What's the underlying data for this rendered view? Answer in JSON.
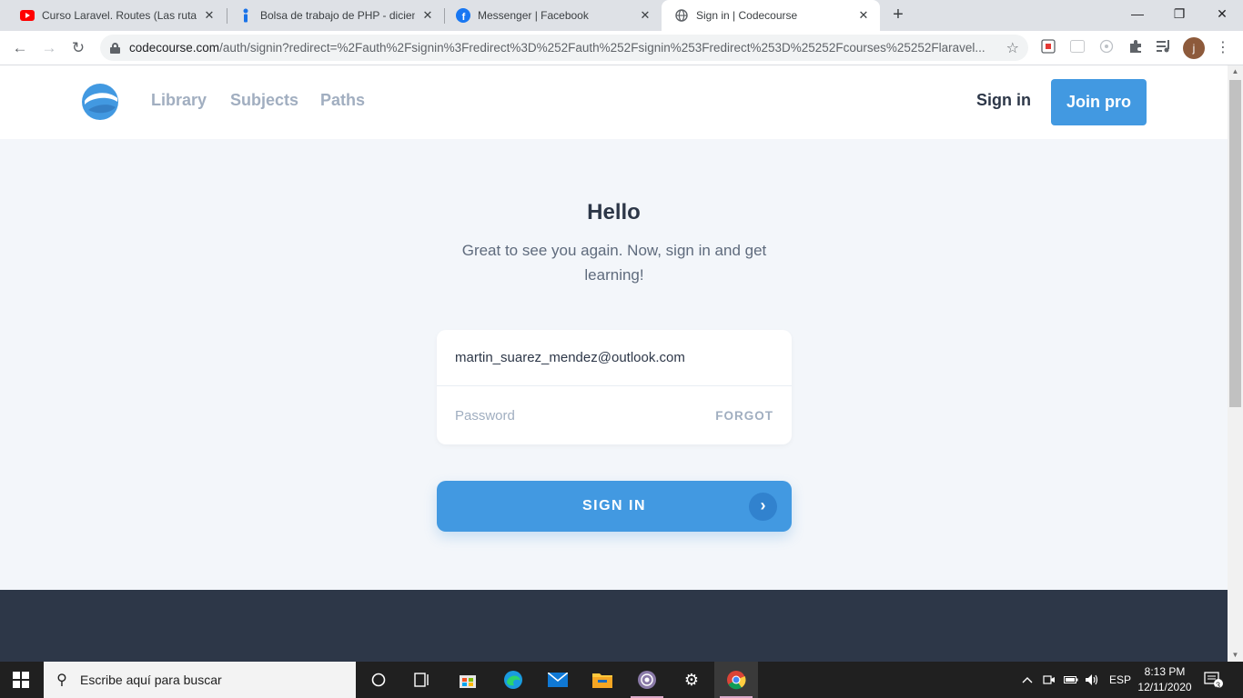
{
  "browser": {
    "tabs": [
      {
        "title": "Curso Laravel. Routes (Las rutas).",
        "favicon": "youtube-icon",
        "active": false
      },
      {
        "title": "Bolsa de trabajo de PHP - diciem",
        "favicon": "info-icon",
        "active": false
      },
      {
        "title": "Messenger | Facebook",
        "favicon": "facebook-icon",
        "active": false
      },
      {
        "title": "Sign in | Codecourse",
        "favicon": "globe-icon",
        "active": true
      }
    ],
    "url_host": "codecourse.com",
    "url_path": "/auth/signin?redirect=%2Fauth%2Fsignin%3Fredirect%3D%252Fauth%252Fsignin%253Fredirect%253D%25252Fcourses%25252Flaravel...",
    "profile_initial": "j"
  },
  "site": {
    "nav": {
      "library": "Library",
      "subjects": "Subjects",
      "paths": "Paths",
      "sign_in": "Sign in",
      "join_pro": "Join pro"
    },
    "title": "Hello",
    "subtitle": "Great to see you again. Now, sign in and get learning!",
    "form": {
      "email_value": "martin_suarez_mendez@outlook.com",
      "password_placeholder": "Password",
      "forgot_label": "FORGOT",
      "submit_label": "SIGN IN"
    },
    "colors": {
      "accent": "#4299e1",
      "footer": "#2d3748"
    }
  },
  "taskbar": {
    "search_placeholder": "Escribe aquí para buscar",
    "language": "ESP",
    "time": "8:13 PM",
    "date": "12/11/2020",
    "notification_count": "3"
  }
}
